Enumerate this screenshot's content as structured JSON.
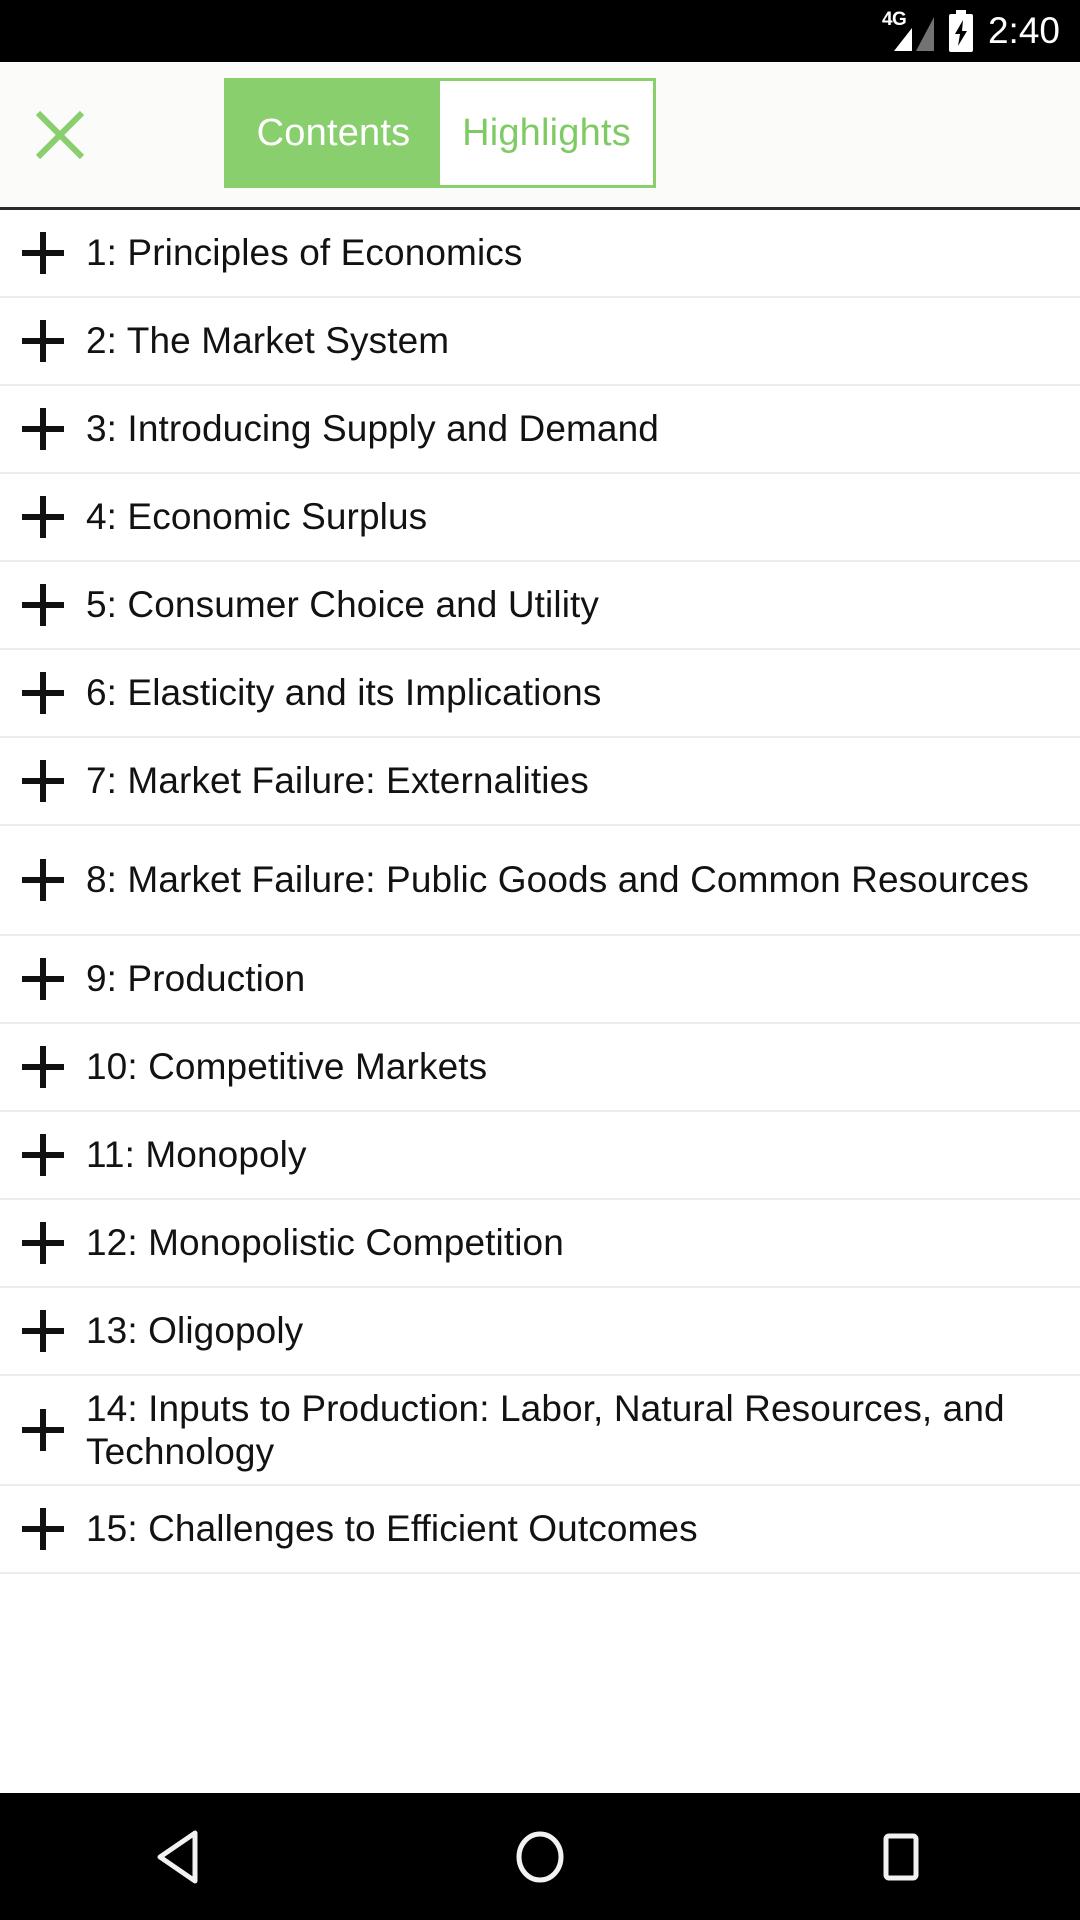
{
  "status_bar": {
    "network_label": "4G",
    "battery_icon": "battery-charging-icon",
    "signal_icon": "signal-bars-icon",
    "time": "2:40"
  },
  "header": {
    "close_icon": "close-x-icon",
    "tabs": [
      {
        "label": "Contents",
        "selected": true
      },
      {
        "label": "Highlights",
        "selected": false
      }
    ]
  },
  "colors": {
    "accent_green": "#8ACF6E",
    "tab_text_green": "#7FCB63",
    "status_bar_bg": "#000000",
    "header_bg": "#fbfbfa",
    "row_divider": "#ececec",
    "text_primary": "#121212"
  },
  "toc": {
    "expand_icon": "plus-icon",
    "items": [
      {
        "label": "1: Principles of Economics"
      },
      {
        "label": "2: The Market System"
      },
      {
        "label": "3: Introducing Supply and Demand"
      },
      {
        "label": "4: Economic Surplus"
      },
      {
        "label": "5: Consumer Choice and Utility"
      },
      {
        "label": "6: Elasticity and its Implications"
      },
      {
        "label": "7: Market Failure: Externalities"
      },
      {
        "label": "8: Market Failure: Public Goods and Common Resources"
      },
      {
        "label": "9: Production"
      },
      {
        "label": "10: Competitive Markets"
      },
      {
        "label": "11: Monopoly"
      },
      {
        "label": "12: Monopolistic Competition"
      },
      {
        "label": "13: Oligopoly"
      },
      {
        "label": "14: Inputs to Production: Labor, Natural Resources, and Technology"
      },
      {
        "label": "15: Challenges to Efficient Outcomes"
      }
    ]
  },
  "nav_bar": {
    "back_icon": "back-triangle-icon",
    "home_icon": "home-circle-icon",
    "recents_icon": "recents-square-icon"
  }
}
